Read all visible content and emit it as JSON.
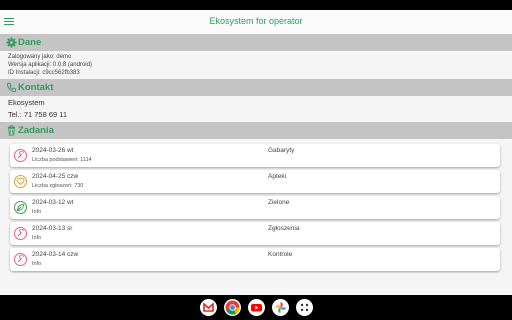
{
  "app": {
    "title": "Ekosystem for operator",
    "accent": "#2e9e5b",
    "menu_icon": "hamburger-menu-icon"
  },
  "dane": {
    "title": "Dane",
    "icon": "gear-icon",
    "lines": [
      "Zalogowany jako: demo",
      "Wersja aplikacji: 0.0.8 (android)",
      "ID Instalacji: c9cc562fb383"
    ]
  },
  "kontakt": {
    "title": "Kontakt",
    "icon": "phone-icon",
    "lines": [
      "Ekosystem",
      "Tel.: 71 758 69 11"
    ]
  },
  "zadania": {
    "title": "Zadania",
    "icon": "trash-icon",
    "items": [
      {
        "date": "2024-03-26 wt",
        "type": "Gabaryty",
        "detail": "Liczba podstawień: 1114",
        "icon": "wrench-icon",
        "icon_color": "#e0607a"
      },
      {
        "date": "2024-04-25 czw",
        "type": "Apteki",
        "detail": "Liczba zgłoszeń: 730",
        "icon": "heart-icon",
        "icon_color": "#d9a030"
      },
      {
        "date": "2024-03-12 wt",
        "type": "Zielone",
        "detail": "Info",
        "icon": "leaf-icon",
        "icon_color": "#3aa24a"
      },
      {
        "date": "2024-03-13 śr",
        "type": "Zgłoszenia",
        "detail": "Info",
        "icon": "wrench-icon",
        "icon_color": "#e0607a"
      },
      {
        "date": "2024-03-14 czw",
        "type": "Kontrole",
        "detail": "Info",
        "icon": "wrench-icon",
        "icon_color": "#e0607a"
      }
    ]
  },
  "dock": {
    "apps": [
      {
        "name": "gmail-icon",
        "color": "#ffffff"
      },
      {
        "name": "chrome-icon",
        "color": "#4285f4"
      },
      {
        "name": "youtube-icon",
        "color": "#ffffff"
      },
      {
        "name": "photos-icon",
        "color": "#ffffff"
      },
      {
        "name": "app-drawer-icon",
        "color": "#ffffff"
      }
    ]
  }
}
